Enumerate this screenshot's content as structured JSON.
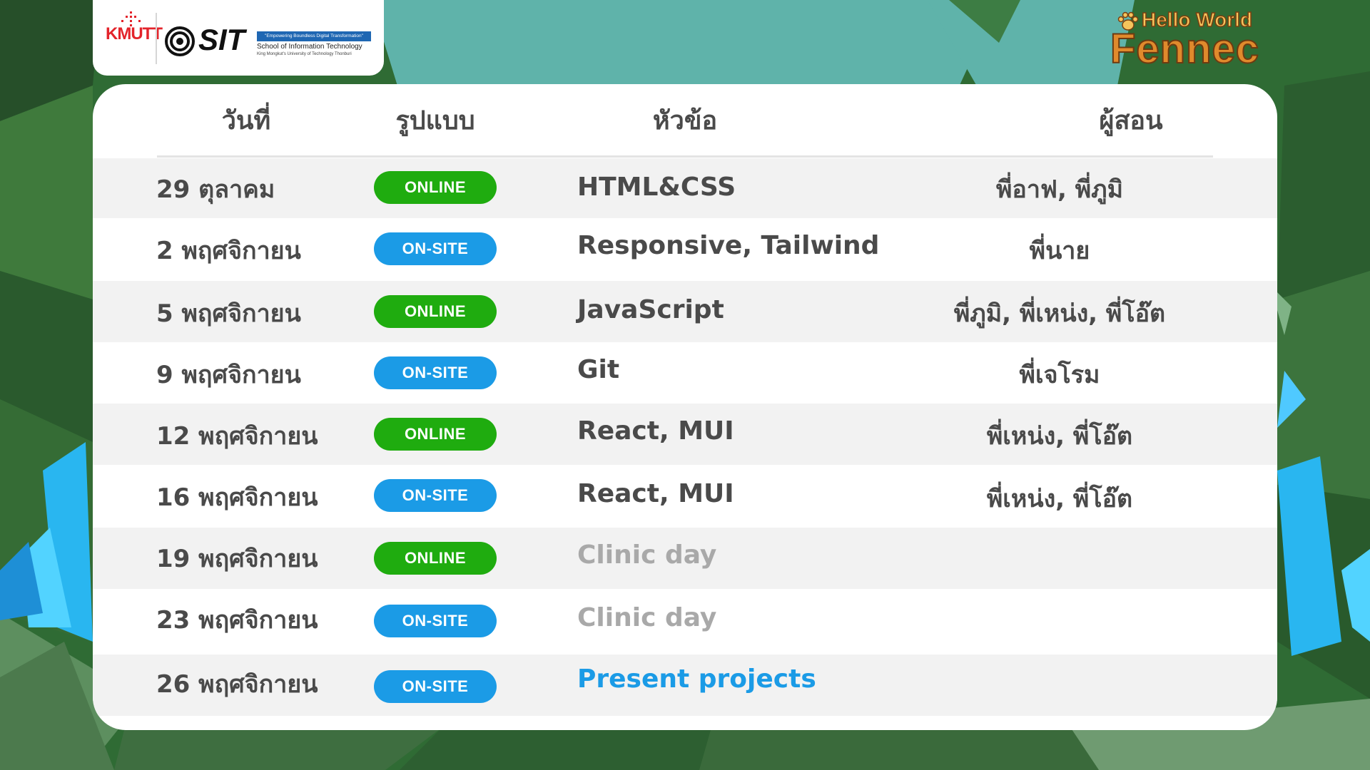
{
  "logos": {
    "kmutt": "KMUTT",
    "sit": "SIT",
    "sit_tagline": "\"Empowering Boundless Digital Transformation\"",
    "sit_school": "School of Information Technology",
    "sit_university": "King Mongkut's University of Technology Thonburi"
  },
  "brand": {
    "top": "Hello World",
    "main": "Fennec"
  },
  "table": {
    "headers": {
      "date": "วันที่",
      "format": "รูปแบบ",
      "topic": "หัวข้อ",
      "teacher": "ผู้สอน"
    },
    "rows": [
      {
        "date": "29 ตุลาคม",
        "format": "ONLINE",
        "topic": "HTML&CSS",
        "teacher": "พี่อาฟ, พี่ภูมิ"
      },
      {
        "date": "2 พฤศจิกายน",
        "format": "ON-SITE",
        "topic": "Responsive, Tailwind",
        "teacher": "พี่นาย"
      },
      {
        "date": "5 พฤศจิกายน",
        "format": "ONLINE",
        "topic": "JavaScript",
        "teacher": "พี่ภูมิ, พี่เหน่ง, พี่โอ๊ต"
      },
      {
        "date": "9 พฤศจิกายน",
        "format": "ON-SITE",
        "topic": "Git",
        "teacher": "พี่เจโรม"
      },
      {
        "date": "12 พฤศจิกายน",
        "format": "ONLINE",
        "topic": "React, MUI",
        "teacher": "พี่เหน่ง, พี่โอ๊ต"
      },
      {
        "date": "16 พฤศจิกายน",
        "format": "ON-SITE",
        "topic": "React, MUI",
        "teacher": "พี่เหน่ง, พี่โอ๊ต"
      },
      {
        "date": "19 พฤศจิกายน",
        "format": "ONLINE",
        "topic": "Clinic day",
        "teacher": ""
      },
      {
        "date": "23 พฤศจิกายน",
        "format": "ON-SITE",
        "topic": "Clinic day",
        "teacher": ""
      },
      {
        "date": "26 พฤศจิกายน",
        "format": "ON-SITE",
        "topic": "Present projects",
        "teacher": ""
      }
    ]
  },
  "colors": {
    "online": "#1fac0f",
    "onsite": "#1b9be6",
    "text": "#4a4a4a",
    "muted": "#a9a9a9",
    "accent": "#1b9be6",
    "background": "#2f6b34",
    "teal": "#5fb3aa"
  }
}
